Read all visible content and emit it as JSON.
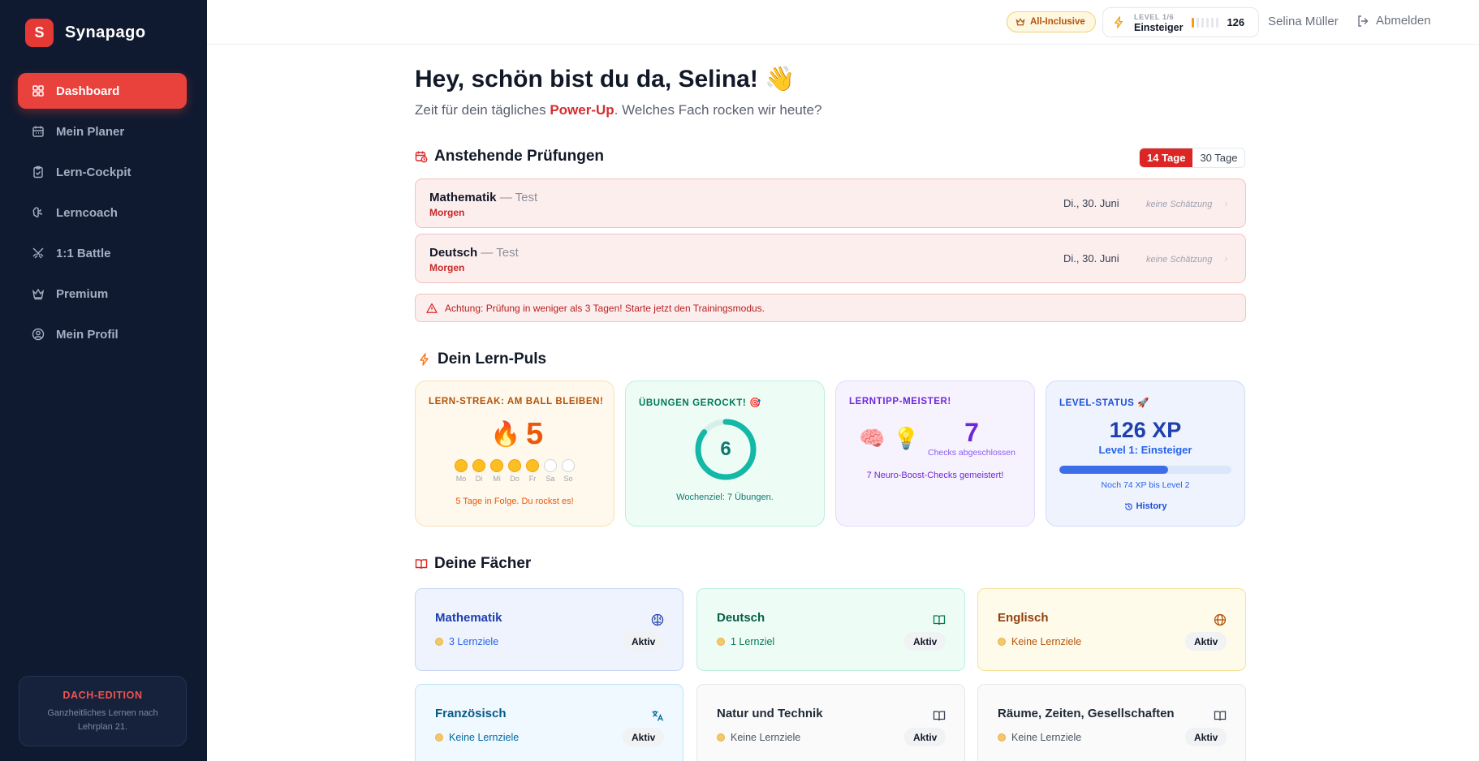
{
  "brand": {
    "logo_letter": "S",
    "name": "Synapago"
  },
  "sidebar": {
    "items": [
      {
        "label": "Dashboard",
        "icon": "grid-icon",
        "active": true
      },
      {
        "label": "Mein Planer",
        "icon": "calendar-icon"
      },
      {
        "label": "Lern-Cockpit",
        "icon": "clipboard-icon"
      },
      {
        "label": "Lerncoach",
        "icon": "brain-icon"
      },
      {
        "label": "1:1 Battle",
        "icon": "swords-icon"
      },
      {
        "label": "Premium",
        "icon": "crown-icon"
      },
      {
        "label": "Mein Profil",
        "icon": "user-circle-icon"
      }
    ],
    "edition": {
      "title": "DACH-EDITION",
      "subtitle": "Ganzheitliches Lernen nach Lehrplan 21."
    }
  },
  "topbar": {
    "plan_badge": "All-Inclusive",
    "level_small": "LEVEL 1/6",
    "level_name": "Einsteiger",
    "level_xp": "126",
    "level_progress": 0.63,
    "user_name": "Selina Müller",
    "logout_label": "Abmelden"
  },
  "greeting": {
    "title": "Hey, schön bist du da, Selina! 👋",
    "sub_before": "Zeit für dein tägliches ",
    "sub_highlight": "Power-Up",
    "sub_after": ". Welches Fach rocken wir heute?"
  },
  "exams": {
    "title": "Anstehende Prüfungen",
    "range_options": [
      "14 Tage",
      "30 Tage"
    ],
    "selected_range": "14 Tage",
    "items": [
      {
        "subject": "Mathematik",
        "type": " — Test",
        "when": "Morgen",
        "date": "Di., 30. Juni",
        "estimate": "keine Schätzung"
      },
      {
        "subject": "Deutsch",
        "type": " — Test",
        "when": "Morgen",
        "date": "Di., 30. Juni",
        "estimate": "keine Schätzung"
      }
    ],
    "warning": "Achtung: Prüfung in weniger als 3 Tagen! Starte jetzt den Trainingsmodus."
  },
  "pulse": {
    "title": "Dein Lern-Puls",
    "streak": {
      "title": "LERN-STREAK: AM BALL BLEIBEN!",
      "value": "5",
      "days": [
        {
          "label": "Mo",
          "done": true
        },
        {
          "label": "Di",
          "done": true
        },
        {
          "label": "Mi",
          "done": true
        },
        {
          "label": "Do",
          "done": true
        },
        {
          "label": "Fr",
          "done": true
        },
        {
          "label": "Sa",
          "done": false
        },
        {
          "label": "So",
          "done": false
        }
      ],
      "footer": "5 Tage in Folge. Du rockst es!"
    },
    "exercises": {
      "title": "ÜBUNGEN GEROCKT! 🎯",
      "value": "6",
      "goal": 7,
      "footer": "Wochenziel: 7 Übungen."
    },
    "tips": {
      "title": "LERNTIPP-MEISTER!",
      "value": "7",
      "label": "Checks abgeschlossen",
      "footer": "7 Neuro-Boost-Checks gemeistert!"
    },
    "level": {
      "title": "LEVEL-STATUS 🚀",
      "xp": "126 XP",
      "level": "Level 1: Einsteiger",
      "progress": 0.63,
      "next": "Noch 74 XP bis Level 2",
      "history_label": "History"
    }
  },
  "subjects": {
    "title": "Deine Fächer",
    "items": [
      {
        "name": "Mathematik",
        "goals": "3 Lernziele",
        "status": "Aktiv",
        "icon": "brain-icon",
        "bg": "#eef3fd",
        "border": "#c9d8f6",
        "color": "#1e40af",
        "goal_color": "#2563eb"
      },
      {
        "name": "Deutsch",
        "goals": "1 Lernziel",
        "status": "Aktiv",
        "icon": "book-icon",
        "bg": "#eefcf6",
        "border": "#bfeedd",
        "color": "#065f46",
        "goal_color": "#047857"
      },
      {
        "name": "Englisch",
        "goals": "Keine Lernziele",
        "status": "Aktiv",
        "icon": "globe-icon",
        "bg": "#fffbea",
        "border": "#f5e19a",
        "color": "#92400e",
        "goal_color": "#b45309"
      },
      {
        "name": "Französisch",
        "goals": "Keine Lernziele",
        "status": "Aktiv",
        "icon": "translate-icon",
        "bg": "#f0f9ff",
        "border": "#bfe3f5",
        "color": "#075985",
        "goal_color": "#0369a1"
      },
      {
        "name": "Natur und Technik",
        "goals": "Keine Lernziele",
        "status": "Aktiv",
        "icon": "book-icon",
        "bg": "#fafafa",
        "border": "#e5e7eb",
        "color": "#1f2937",
        "goal_color": "#4b5563"
      },
      {
        "name": "Räume, Zeiten, Gesellschaften",
        "goals": "Keine Lernziele",
        "status": "Aktiv",
        "icon": "book-icon",
        "bg": "#fafafa",
        "border": "#e5e7eb",
        "color": "#1f2937",
        "goal_color": "#4b5563"
      }
    ]
  }
}
